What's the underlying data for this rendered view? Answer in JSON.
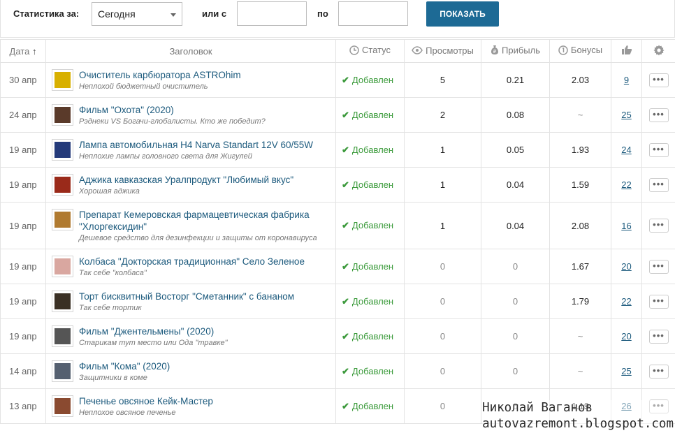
{
  "filters": {
    "stats_label": "Статистика за:",
    "period_value": "Сегодня",
    "from_label": "или с",
    "to_label": "по",
    "from_value": "",
    "to_value": "",
    "show_button": "ПОКАЗАТЬ"
  },
  "columns": {
    "date": "Дата",
    "title": "Заголовок",
    "status": "Статус",
    "views": "Просмотры",
    "profit": "Прибыль",
    "bonus": "Бонусы"
  },
  "rows": [
    {
      "date": "30 апр",
      "title": "Очиститель карбюратора ASTROhim",
      "subtitle": "Неплохой бюджетный очиститель",
      "status": "Добавлен",
      "views": "5",
      "profit": "0.21",
      "bonus": "2.03",
      "likes": "9",
      "thumb": "#d8b000"
    },
    {
      "date": "24 апр",
      "title": "Фильм \"Охота\" (2020)",
      "subtitle": "Рэднеки VS Богачи-глобалисты. Кто же победит?",
      "status": "Добавлен",
      "views": "2",
      "profit": "0.08",
      "bonus": "~",
      "likes": "25",
      "thumb": "#5a3a2a"
    },
    {
      "date": "19 апр",
      "title": "Лампа автомобильная H4 Narva Standart 12V 60/55W",
      "subtitle": "Неплохие лампы головного света для Жигулей",
      "status": "Добавлен",
      "views": "1",
      "profit": "0.05",
      "bonus": "1.93",
      "likes": "24",
      "thumb": "#243a7a"
    },
    {
      "date": "19 апр",
      "title": "Аджика кавказская Уралпродукт \"Любимый вкус\"",
      "subtitle": "Хорошая аджика",
      "status": "Добавлен",
      "views": "1",
      "profit": "0.04",
      "bonus": "1.59",
      "likes": "22",
      "thumb": "#9a2a1a"
    },
    {
      "date": "19 апр",
      "title": "Препарат Кемеровская фармацевтическая фабрика \"Хлоргексидин\"",
      "subtitle": "Дешевое средство для дезинфекции и защиты от коронавируса",
      "status": "Добавлен",
      "views": "1",
      "profit": "0.04",
      "bonus": "2.08",
      "likes": "16",
      "thumb": "#b07a30"
    },
    {
      "date": "19 апр",
      "title": "Колбаса \"Докторская традиционная\" Село Зеленое",
      "subtitle": "Так себе \"колбаса\"",
      "status": "Добавлен",
      "views": "0",
      "profit": "0",
      "bonus": "1.67",
      "likes": "20",
      "thumb": "#d9a7a0"
    },
    {
      "date": "19 апр",
      "title": "Торт бисквитный Восторг \"Сметанник\" с бананом",
      "subtitle": "Так себе тортик",
      "status": "Добавлен",
      "views": "0",
      "profit": "0",
      "bonus": "1.79",
      "likes": "22",
      "thumb": "#3a3024"
    },
    {
      "date": "19 апр",
      "title": "Фильм \"Джентельмены\" (2020)",
      "subtitle": "Старикам тут место или Ода \"травке\"",
      "status": "Добавлен",
      "views": "0",
      "profit": "0",
      "bonus": "~",
      "likes": "20",
      "thumb": "#555555"
    },
    {
      "date": "14 апр",
      "title": "Фильм \"Кома\" (2020)",
      "subtitle": "Защитники в коме",
      "status": "Добавлен",
      "views": "0",
      "profit": "0",
      "bonus": "~",
      "likes": "25",
      "thumb": "#556070"
    },
    {
      "date": "13 апр",
      "title": "Печенье овсяное Кейк-Мастер",
      "subtitle": "Неплохое овсяное печенье",
      "status": "Добавлен",
      "views": "0",
      "profit": "0",
      "bonus": "1.19",
      "likes": "26",
      "thumb": "#8a4a30"
    }
  ],
  "watermark": {
    "line1": "Николай Ваганов",
    "line2": "autovazremont.blogspot.com"
  }
}
